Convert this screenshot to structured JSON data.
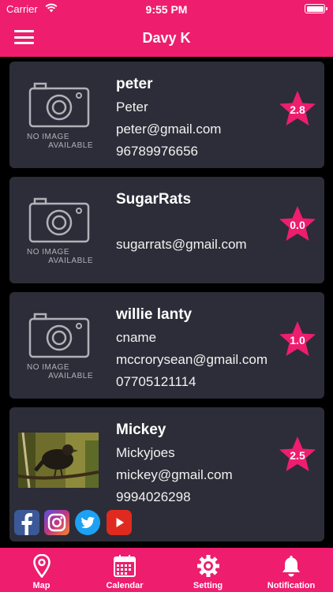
{
  "status": {
    "carrier": "Carrier",
    "time": "9:55 PM"
  },
  "header": {
    "title": "Davy K"
  },
  "no_image": {
    "line1": "NO IMAGE",
    "line2": "AVAILABLE"
  },
  "contacts": [
    {
      "name": "peter",
      "cname": "Peter",
      "email": "peter@gmail.com",
      "phone": "96789976656",
      "rating": "2.8"
    },
    {
      "name": "SugarRats",
      "cname": "",
      "email": "sugarrats@gmail.com",
      "phone": "",
      "rating": "0.0"
    },
    {
      "name": "willie lanty",
      "cname": "cname",
      "email": "mccrorysean@gmail.com",
      "phone": "07705121114",
      "rating": "1.0"
    },
    {
      "name": "Mickey",
      "cname": "Mickyjoes",
      "email": "mickey@gmail.com",
      "phone": "9994026298",
      "rating": "2.5"
    }
  ],
  "social_icons": [
    "facebook-icon",
    "instagram-icon",
    "twitter-icon",
    "youtube-icon"
  ],
  "tabs": [
    {
      "label": "Map",
      "icon": "map-pin-icon"
    },
    {
      "label": "Calendar",
      "icon": "calendar-icon"
    },
    {
      "label": "Setting",
      "icon": "gear-icon"
    },
    {
      "label": "Notification",
      "icon": "bell-icon"
    }
  ],
  "colors": {
    "brand": "#ee1d6e",
    "card": "#2c2d38",
    "background": "#000000"
  }
}
